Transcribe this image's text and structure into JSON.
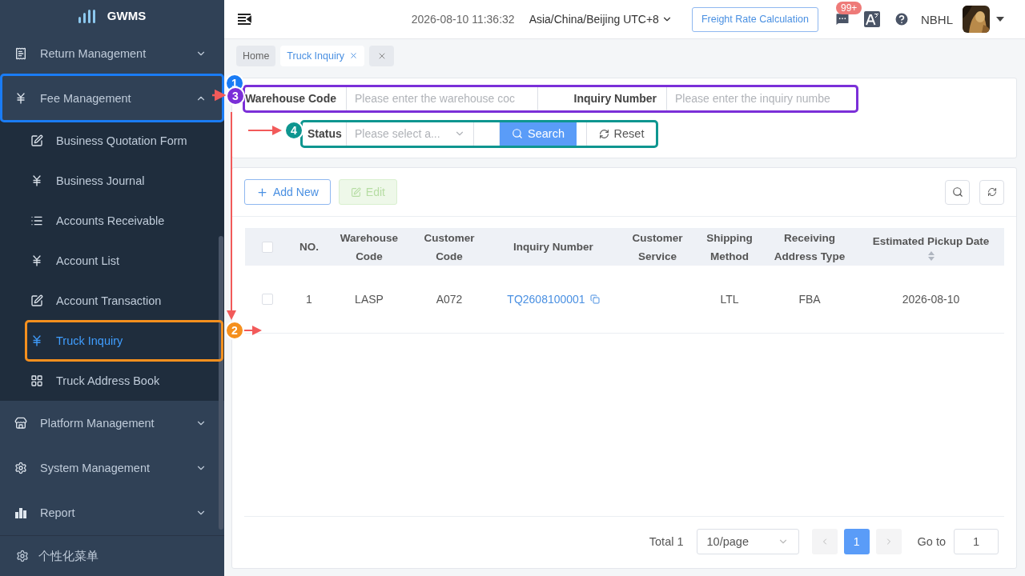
{
  "sidebar": {
    "logo": "GWMS",
    "menu": [
      {
        "label": "Return Management",
        "expanded": false,
        "selected": false
      },
      {
        "label": "Fee Management",
        "expanded": true,
        "selected": false,
        "children": [
          {
            "label": "Business Quotation Form",
            "selected": false
          },
          {
            "label": "Business Journal",
            "selected": false
          },
          {
            "label": "Accounts Receivable",
            "selected": false
          },
          {
            "label": "Account List",
            "selected": false
          },
          {
            "label": "Account Transaction",
            "selected": false
          },
          {
            "label": "Truck Inquiry",
            "selected": true
          },
          {
            "label": "Truck Address Book",
            "selected": false
          }
        ]
      },
      {
        "label": "Platform Management",
        "expanded": false,
        "selected": false
      },
      {
        "label": "System Management",
        "expanded": false,
        "selected": false
      },
      {
        "label": "Report",
        "expanded": false,
        "selected": false
      }
    ],
    "footer": "个性化菜单"
  },
  "header": {
    "datetime": "2026-08-10 11:36:32",
    "timezone": "Asia/China/Beijing UTC+8",
    "freight_button": "Freight Rate Calculation",
    "message_badge": "99+",
    "user": "NBHL"
  },
  "tabs": [
    {
      "label": "Home",
      "selected": false
    },
    {
      "label": "Truck Inquiry",
      "selected": true
    }
  ],
  "search": {
    "fields": [
      {
        "label": "Warehouse Code",
        "placeholder": "Please enter the warehouse coc"
      },
      {
        "label": "Inquiry Number",
        "placeholder": "Please enter the inquiry numbe"
      }
    ],
    "status": {
      "label": "Status",
      "placeholder": "Please select a..."
    },
    "search_button": "Search",
    "reset_button": "Reset"
  },
  "toolbar": {
    "add_button": {
      "label": "Add New",
      "disabled": false
    },
    "edit_button": {
      "label": "Edit",
      "disabled": true
    }
  },
  "table": {
    "all_checked": false,
    "columns": [
      {
        "label": "NO.",
        "sortable": false
      },
      {
        "label": "Warehouse Code",
        "sortable": false
      },
      {
        "label": "Customer Code",
        "sortable": false
      },
      {
        "label": "Inquiry Number",
        "sortable": false
      },
      {
        "label": "Customer Service",
        "sortable": false
      },
      {
        "label": "Shipping Method",
        "sortable": false
      },
      {
        "label": "Receiving Address Type",
        "sortable": false
      },
      {
        "label": "Estimated Pickup Date",
        "sortable": true
      }
    ],
    "rows": [
      {
        "checked": false,
        "cells": [
          "1",
          "LASP",
          "A072",
          "TQ2608100001",
          null,
          "LTL",
          "FBA",
          "2026-08-10"
        ]
      }
    ]
  },
  "pagination": {
    "total": "Total 1",
    "page_size": "10/page",
    "pages": [
      {
        "label": "1",
        "selected": true
      }
    ],
    "goto_label": "Go to",
    "goto_value": "1"
  },
  "annotations": [
    {
      "number": "1",
      "color": "#1a7cf5"
    },
    {
      "number": "3",
      "color": "#7b2fd8"
    },
    {
      "number": "4",
      "color": "#0e9690"
    },
    {
      "number": "2",
      "color": "#f5901e"
    }
  ]
}
